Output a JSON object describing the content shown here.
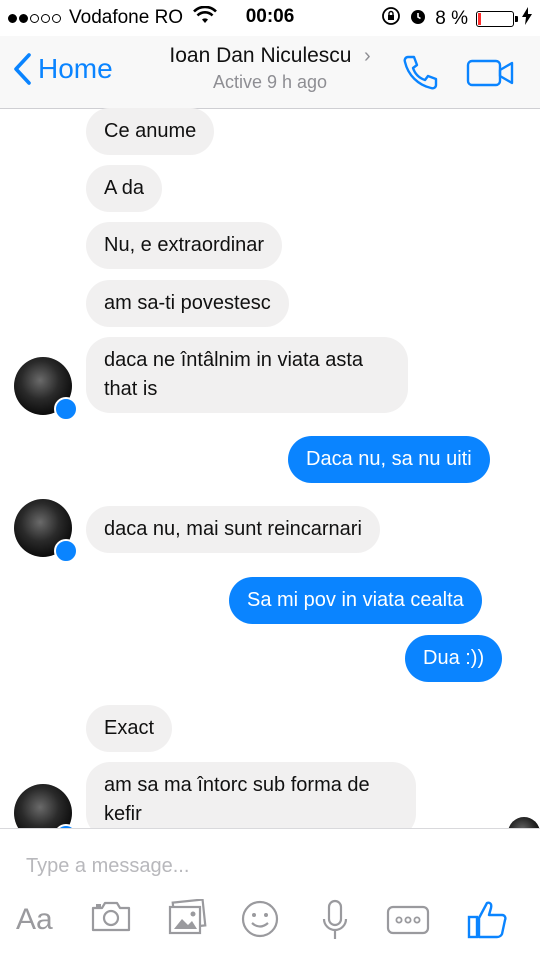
{
  "status_bar": {
    "carrier": "Vodafone RO",
    "time": "00:06",
    "battery": "8 %",
    "battery_level": 0.08,
    "signal_bars": 2
  },
  "nav": {
    "back_label": "Home",
    "contact_name": "Ioan Dan Niculescu",
    "contact_status": "Active 9 h ago"
  },
  "messages": [
    {
      "from": "them",
      "text": "Ce anume"
    },
    {
      "from": "them",
      "text": "A da"
    },
    {
      "from": "them",
      "text": "Nu, e extraordinar"
    },
    {
      "from": "them",
      "text": "am sa-ti povestesc"
    },
    {
      "from": "them",
      "text": "daca ne întâlnim in viata asta that is"
    },
    {
      "from": "me",
      "text": "Daca nu, sa nu uiti"
    },
    {
      "from": "them",
      "text": "daca nu, mai sunt reincarnari"
    },
    {
      "from": "me",
      "text": "Sa mi pov in viata cealta"
    },
    {
      "from": "me",
      "text": "Dua :))"
    },
    {
      "from": "them",
      "text": "Exact"
    },
    {
      "from": "them",
      "text": "am sa ma întorc sub forma de kefir"
    }
  ],
  "composer": {
    "placeholder": "Type a message...",
    "aa_label": "Aa"
  },
  "colors": {
    "accent": "#0a84ff",
    "incoming_bubble": "#f1f0f0",
    "battery_low": "#ff2d2d"
  },
  "icons": [
    "back-chevron-icon",
    "phone-icon",
    "video-camera-icon",
    "camera-icon",
    "photo-icon",
    "emoji-icon",
    "microphone-icon",
    "more-icon",
    "thumbs-up-icon"
  ]
}
